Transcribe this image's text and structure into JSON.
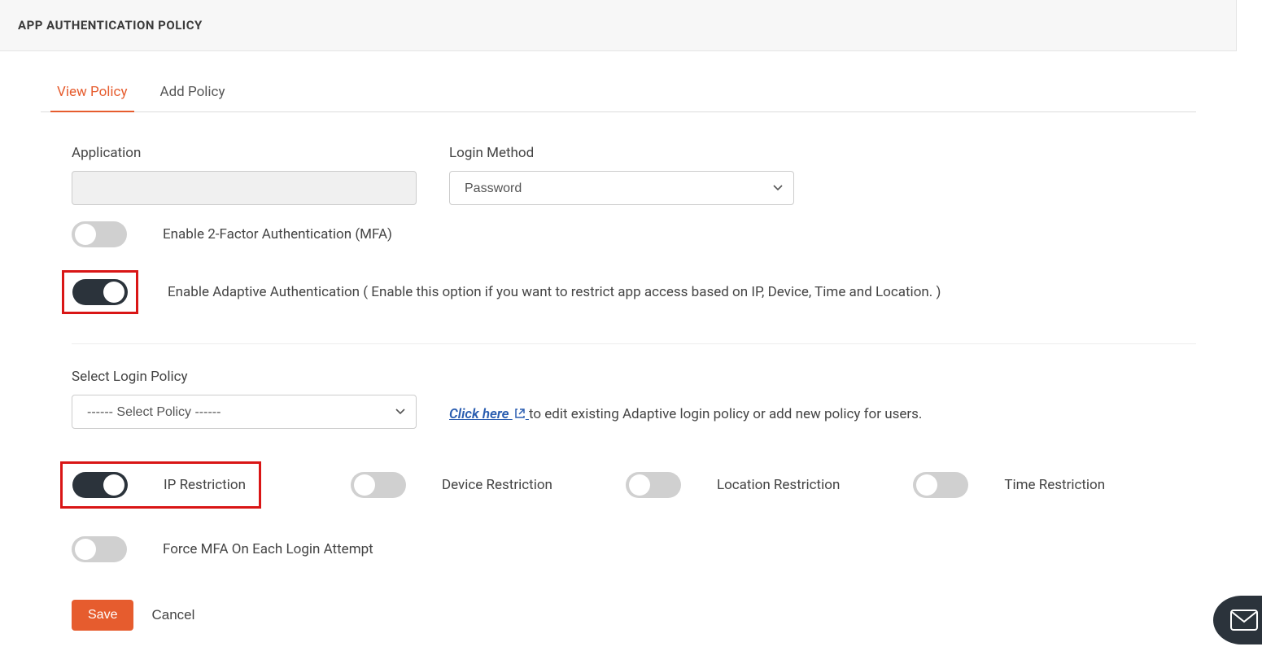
{
  "header": {
    "title": "APP AUTHENTICATION POLICY"
  },
  "tabs": {
    "view": "View Policy",
    "add": "Add Policy"
  },
  "form": {
    "application_label": "Application",
    "application_value": "",
    "login_method_label": "Login Method",
    "login_method_value": "Password",
    "mfa_label": "Enable 2-Factor Authentication (MFA)",
    "adaptive_label": "Enable Adaptive Authentication ( Enable this option if you want to restrict app access based on IP, Device, Time and Location. )",
    "select_policy_label": "Select Login Policy",
    "select_policy_value": "------ Select Policy ------",
    "hint_link": "Click here",
    "hint_rest": " to edit existing Adaptive login policy or add new policy for users.",
    "ip_restriction": "IP Restriction",
    "device_restriction": "Device Restriction",
    "location_restriction": "Location Restriction",
    "time_restriction": "Time Restriction",
    "force_mfa": "Force MFA On Each Login Attempt",
    "save": "Save",
    "cancel": "Cancel"
  }
}
